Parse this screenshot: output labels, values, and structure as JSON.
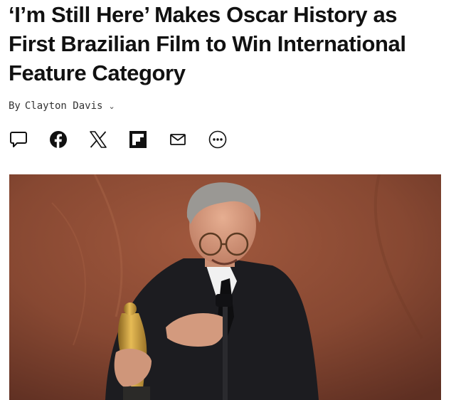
{
  "article": {
    "headline_lines": [
      "‘I’m Still Here’ Makes Oscar History as",
      "First Brazilian Film to Win International",
      "Feature Category"
    ],
    "byline_prefix": "By",
    "author": "Clayton Davis",
    "author_menu_icon": "chevron-down-icon"
  },
  "share": {
    "icons": [
      "comment-icon",
      "facebook-icon",
      "x-icon",
      "flipboard-icon",
      "email-icon",
      "more-icon"
    ]
  },
  "hero": {
    "image": "photo of a smiling gray-haired man in glasses and a dark suit holding an Oscar statuette on stage",
    "palette": {
      "background": "#8a4a35",
      "suit": "#1c1c20",
      "skin": "#d9a083",
      "hair": "#9a9894",
      "gold": "#c99a3a"
    }
  }
}
